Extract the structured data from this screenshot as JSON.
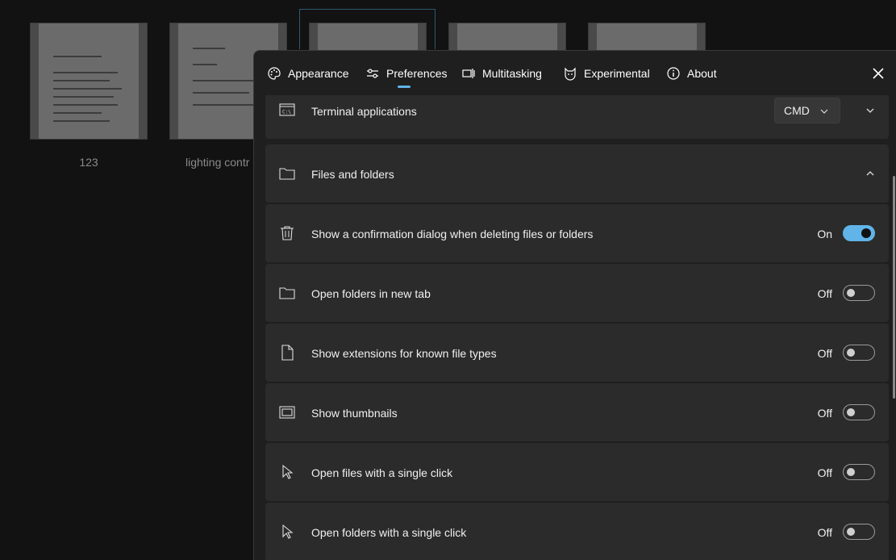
{
  "background": {
    "files": [
      {
        "label": "123"
      },
      {
        "label": "lighting contr"
      }
    ]
  },
  "dialog": {
    "tabs": [
      {
        "label": "Appearance",
        "icon": "palette-icon"
      },
      {
        "label": "Preferences",
        "icon": "sliders-icon"
      },
      {
        "label": "Multitasking",
        "icon": "multitasking-icon"
      },
      {
        "label": "Experimental",
        "icon": "cat-icon"
      },
      {
        "label": "About",
        "icon": "info-icon"
      }
    ],
    "active_tab": "Preferences",
    "terminal": {
      "label": "Terminal applications",
      "selected": "CMD"
    },
    "files_section": {
      "label": "Files and folders"
    },
    "settings": [
      {
        "label": "Show a confirmation dialog when deleting files or folders",
        "state": "On",
        "icon": "trash-icon"
      },
      {
        "label": "Open folders in new tab",
        "state": "Off",
        "icon": "folder-icon"
      },
      {
        "label": "Show extensions for known file types",
        "state": "Off",
        "icon": "file-icon"
      },
      {
        "label": "Show thumbnails",
        "state": "Off",
        "icon": "thumbnail-icon"
      },
      {
        "label": "Open files with a single click",
        "state": "Off",
        "icon": "cursor-icon"
      },
      {
        "label": "Open folders with a single click",
        "state": "Off",
        "icon": "cursor-icon"
      }
    ],
    "accent_color": "#60b4e8"
  }
}
